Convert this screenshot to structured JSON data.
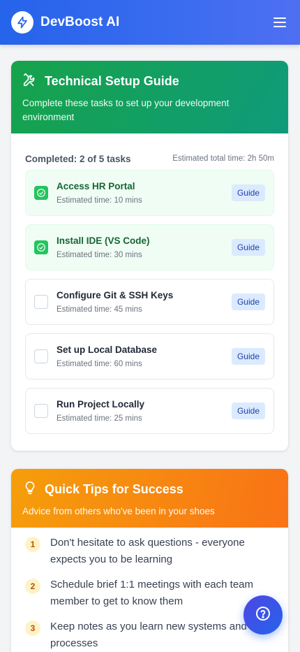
{
  "header": {
    "app_name": "DevBoost AI",
    "logo_icon": "lightning-bolt-icon",
    "menu_icon": "hamburger-menu-icon"
  },
  "setup": {
    "title": "Technical Setup Guide",
    "subtitle": "Complete these tasks to set up your development environment",
    "icon": "wrench-screwdriver-icon",
    "completed_label": "Completed: 2 of 5 tasks",
    "estimated_total": "Estimated total time: 2h 50m",
    "tasks": [
      {
        "title": "Access HR Portal",
        "estimate": "Estimated time: 10 mins",
        "done": true,
        "action": "Guide"
      },
      {
        "title": "Install IDE (VS Code)",
        "estimate": "Estimated time: 30 mins",
        "done": true,
        "action": "Guide"
      },
      {
        "title": "Configure Git & SSH Keys",
        "estimate": "Estimated time: 45 mins",
        "done": false,
        "action": "Guide"
      },
      {
        "title": "Set up Local Database",
        "estimate": "Estimated time: 60 mins",
        "done": false,
        "action": "Guide"
      },
      {
        "title": "Run Project Locally",
        "estimate": "Estimated time: 25 mins",
        "done": false,
        "action": "Guide"
      }
    ]
  },
  "tips": {
    "title": "Quick Tips for Success",
    "subtitle": "Advice from others who've been in your shoes",
    "icon": "lightbulb-icon",
    "items": [
      {
        "number": "1",
        "text": "Don't hesitate to ask questions - everyone expects you to be learning"
      },
      {
        "number": "2",
        "text": "Schedule brief 1:1 meetings with each team member to get to know them"
      },
      {
        "number": "3",
        "text": "Keep notes as you learn new systems and processes"
      }
    ]
  },
  "help": {
    "icon": "question-circle-icon"
  },
  "colors": {
    "primary": "#2563eb",
    "success": "#22c55e",
    "setup_header": "#16a34a",
    "tips_header": "#f97316"
  }
}
